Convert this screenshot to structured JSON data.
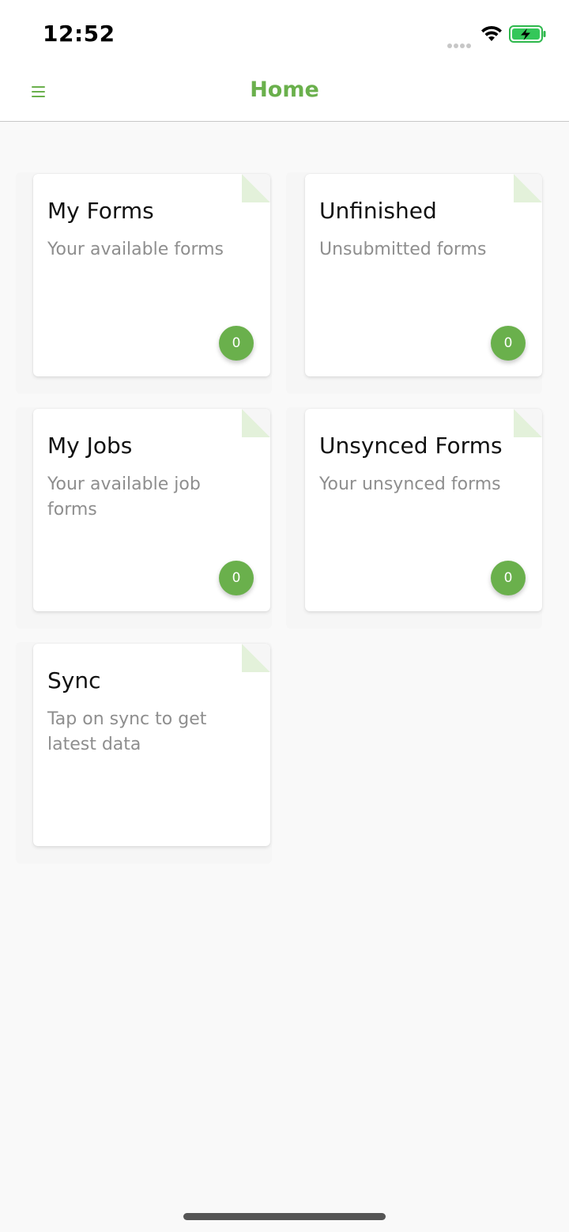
{
  "status_bar": {
    "time": "12:52",
    "icons": [
      "cellular-signal-icon",
      "wifi-icon",
      "battery-charging-icon"
    ]
  },
  "nav": {
    "title": "Home",
    "menu_icon": "hamburger-menu-icon"
  },
  "colors": {
    "accent": "#6ab04c",
    "fold": "#e3f1da",
    "background": "#f9f9f9"
  },
  "tiles": [
    {
      "title": "My Forms",
      "subtitle": "Your available forms",
      "count": "0"
    },
    {
      "title": "Unfinished",
      "subtitle": "Unsubmitted forms",
      "count": "0"
    },
    {
      "title": "My Jobs",
      "subtitle": "Your available job forms",
      "count": "0"
    },
    {
      "title": "Unsynced Forms",
      "subtitle": "Your unsynced forms",
      "count": "0"
    },
    {
      "title": "Sync",
      "subtitle": "Tap on sync to get latest data"
    }
  ]
}
